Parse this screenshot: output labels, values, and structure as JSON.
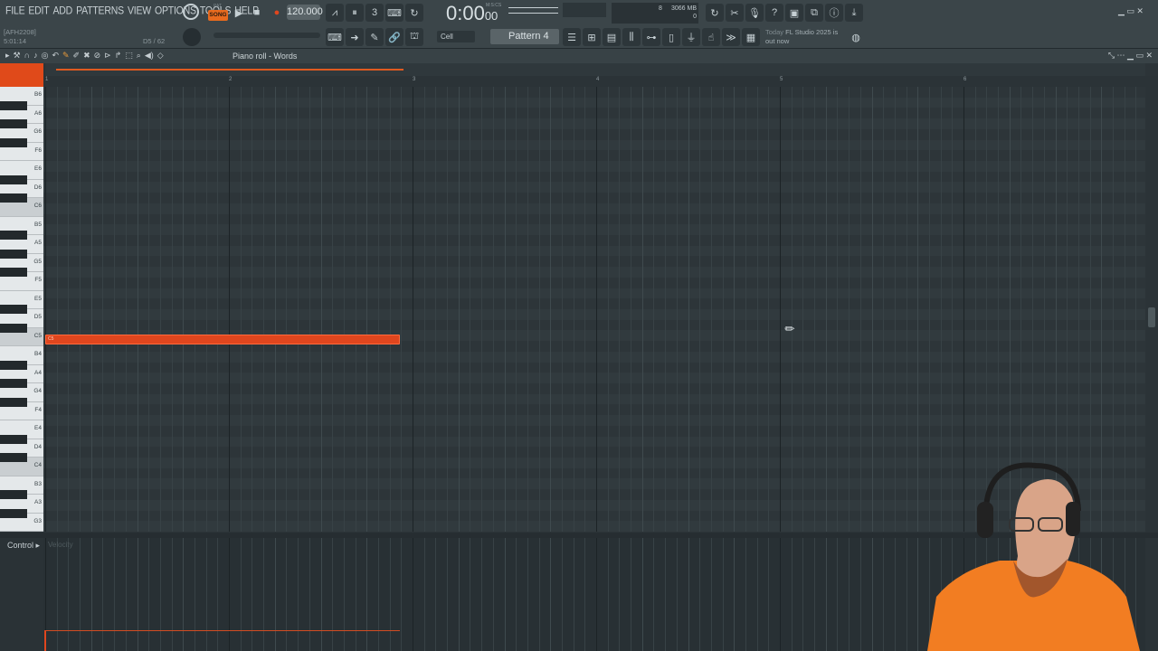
{
  "menu": [
    "FILE",
    "EDIT",
    "ADD",
    "PATTERNS",
    "VIEW",
    "OPTIONS",
    "TOOLS",
    "HELP"
  ],
  "hint": {
    "line1": "[AFH2208]",
    "line2": "5:01:14",
    "pos": "D5 / 62"
  },
  "transport": {
    "pat_label": "PAT",
    "song_label": "SONG",
    "tempo": "120.000",
    "time": "0:00",
    "time_small": "00",
    "mscs": "M:S:CS"
  },
  "cpu": {
    "num": "8",
    "mem": "3066 MB",
    "voices": "0"
  },
  "toolbar2": {
    "snap": "Cell",
    "pattern": "Pattern 4"
  },
  "news": {
    "date": "Today",
    "line1": "FL Studio 2025 is",
    "line2": "out now"
  },
  "pianoroll": {
    "title": "Piano roll - Words"
  },
  "ruler": [
    "1",
    "2",
    "3",
    "4",
    "5",
    "6"
  ],
  "keys": [
    "B6",
    "A6",
    "G6",
    "F6",
    "E6",
    "D6",
    "C6",
    "B5",
    "A5",
    "G5",
    "F5",
    "E5",
    "D5",
    "C5",
    "B4",
    "A4",
    "G4",
    "F4",
    "E4",
    "D4",
    "C4",
    "B3",
    "A3",
    "G3"
  ],
  "note": {
    "label": "C5"
  },
  "control": {
    "label": "Control",
    "param": "Velocity"
  },
  "colors": {
    "accent": "#e0461e",
    "grid_bg": "#313a3e",
    "toolbar": "#3b4549"
  },
  "icons": [
    "gear-icon",
    "play-icon",
    "stop-icon",
    "record-icon",
    "pencil-icon",
    "brush-icon",
    "delete-icon",
    "mute-icon",
    "select-icon",
    "zoom-icon",
    "speaker-icon",
    "help-icon",
    "save-icon",
    "info-icon",
    "download-icon",
    "mic-icon",
    "cursor-icon"
  ]
}
